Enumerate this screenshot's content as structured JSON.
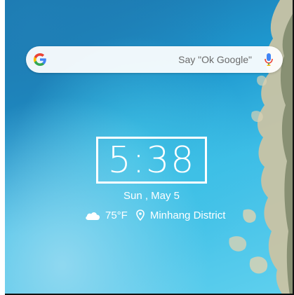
{
  "search": {
    "hint": "Say \"Ok Google\"",
    "logo_icon": "google-g-icon",
    "mic_icon": "microphone-icon"
  },
  "clock": {
    "time": "5:38",
    "date": "Sun , May 5"
  },
  "weather": {
    "icon": "partly-cloudy-icon",
    "temperature": "75°F",
    "location_icon": "location-pin-icon",
    "location": "Minhang District"
  },
  "colors": {
    "google_blue": "#4285F4",
    "google_red": "#EA4335",
    "google_yellow": "#FBBC05",
    "google_green": "#34A853",
    "sea": "#2fb0e0"
  }
}
